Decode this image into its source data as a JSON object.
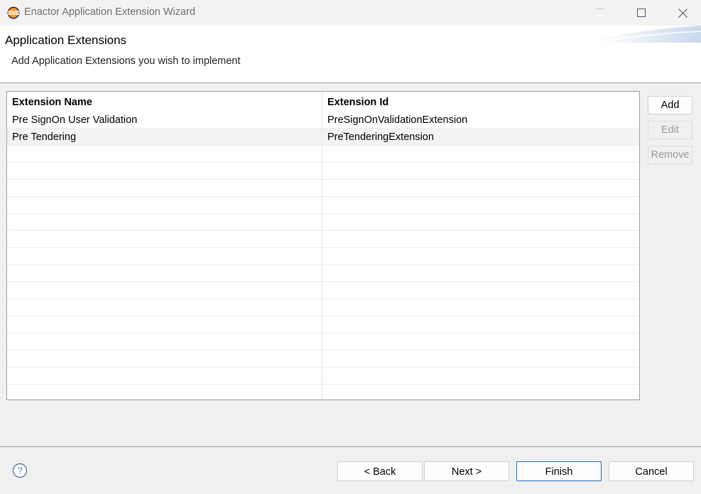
{
  "window": {
    "title": "Enactor Application Extension Wizard",
    "icons": {
      "app": "eclipse-icon",
      "minimize": "minimize-icon",
      "maximize": "maximize-icon",
      "close": "close-icon"
    }
  },
  "header": {
    "title": "Application Extensions",
    "description": "Add Application Extensions you wish to implement"
  },
  "table": {
    "columns": [
      "Extension Name",
      "Extension Id"
    ],
    "rows": [
      [
        "Pre SignOn User Validation",
        "PreSignOnValidationExtension"
      ],
      [
        "Pre Tendering",
        "PreTenderingExtension"
      ],
      [
        "",
        ""
      ],
      [
        "",
        ""
      ],
      [
        "",
        ""
      ],
      [
        "",
        ""
      ],
      [
        "",
        ""
      ],
      [
        "",
        ""
      ],
      [
        "",
        ""
      ],
      [
        "",
        ""
      ],
      [
        "",
        ""
      ],
      [
        "",
        ""
      ],
      [
        "",
        ""
      ],
      [
        "",
        ""
      ],
      [
        "",
        ""
      ],
      [
        "",
        ""
      ],
      [
        "",
        ""
      ],
      [
        "",
        ""
      ]
    ],
    "selected_row": 1
  },
  "side_buttons": {
    "add": "Add",
    "edit": "Edit",
    "remove": "Remove"
  },
  "footer": {
    "help_icon": "help-icon",
    "back": "< Back",
    "next": "Next >",
    "finish": "Finish",
    "cancel": "Cancel"
  },
  "colors": {
    "background": "#f0f0f0",
    "header_background": "#ffffff",
    "default_button_border": "#1a6fc9",
    "disabled_text": "#9a9a9a"
  }
}
